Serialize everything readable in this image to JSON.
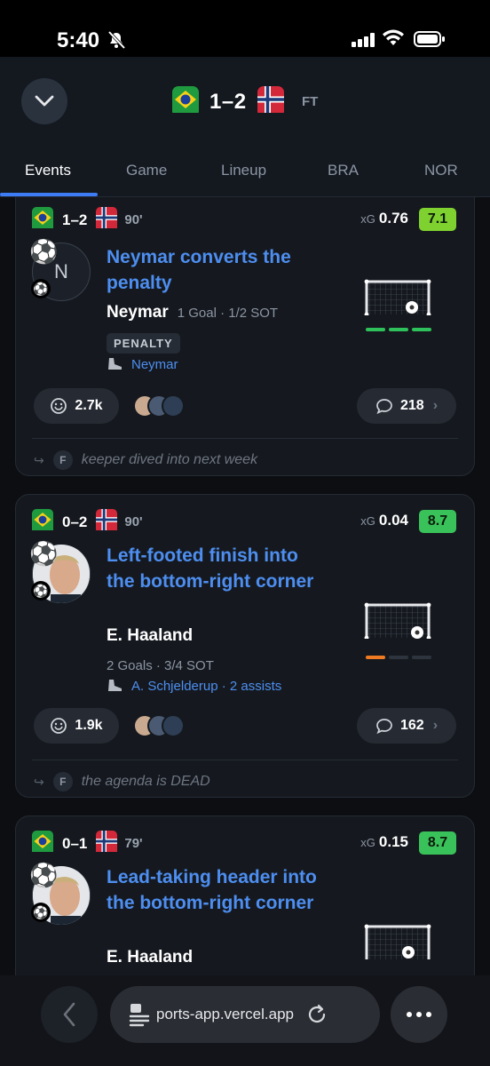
{
  "status_bar": {
    "time": "5:40"
  },
  "match": {
    "score": "1–2",
    "status": "FT",
    "home": "Brazil",
    "away": "Norway"
  },
  "tabs": [
    {
      "label": "Events",
      "active": true
    },
    {
      "label": "Game",
      "active": false
    },
    {
      "label": "Lineup",
      "active": false
    },
    {
      "label": "BRA",
      "active": false
    },
    {
      "label": "NOR",
      "active": false
    }
  ],
  "events": [
    {
      "score": "1–2",
      "minute": "90'",
      "xg_label": "xG",
      "xg": "0.76",
      "rating": "7.1",
      "rating_color": "#7fd12f",
      "avatar_initial": "N",
      "title": "Neymar converts the penalty",
      "player": "Neymar",
      "player_stats": "1 Goal · 1/2 SOT",
      "tag": "PENALTY",
      "assist": "Neymar",
      "reactions": "2.7k",
      "comments": "218",
      "reply_initial": "F",
      "reply": "keeper dived into next week"
    },
    {
      "score": "0–2",
      "minute": "90'",
      "xg_label": "xG",
      "xg": "0.04",
      "rating": "8.7",
      "rating_color": "#3ac25a",
      "title": "Left-footed finish into the bottom-right corner",
      "player": "E. Haaland",
      "player_stats": "2 Goals · 3/4 SOT",
      "assist": "A. Schjelderup · 2 assists",
      "reactions": "1.9k",
      "comments": "162",
      "reply_initial": "F",
      "reply": "the agenda is DEAD"
    },
    {
      "score": "0–1",
      "minute": "79'",
      "xg_label": "xG",
      "xg": "0.15",
      "rating": "8.7",
      "rating_color": "#3ac25a",
      "title": "Lead-taking header into the bottom-right corner",
      "player": "E. Haaland"
    }
  ],
  "browser": {
    "url": "ports-app.vercel.app"
  },
  "colors": {
    "accent": "#3d7cf5",
    "link": "#4d8ef0",
    "bar_on_green": "#2ec05a",
    "bar_on_orange": "#f07a22"
  },
  "icons": [
    "bell-slash-icon",
    "signal-icon",
    "wifi-icon",
    "battery-icon",
    "chevron-down-icon",
    "football-icon",
    "boot-icon",
    "smiley-icon",
    "speech-bubble-icon",
    "chevron-right-icon",
    "reply-arrow-icon",
    "back-arrow-icon",
    "tabs-icon",
    "reload-icon",
    "more-icon",
    "goal-net-icon"
  ]
}
